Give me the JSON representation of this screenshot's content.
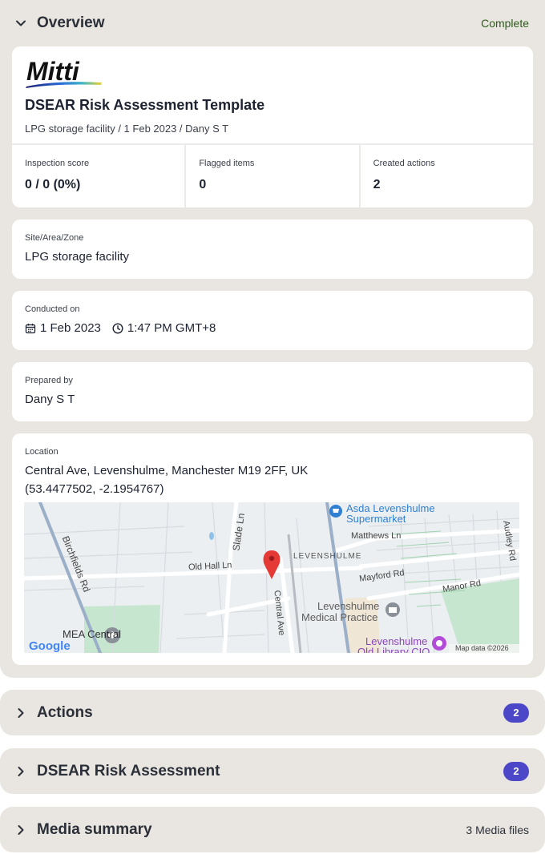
{
  "overview": {
    "title": "Overview",
    "status": "Complete",
    "logo_text": "Mitti",
    "template_title": "DSEAR Risk Assessment Template",
    "subtitle": "LPG storage facility / 1 Feb 2023 / Dany S T",
    "stats": [
      {
        "label": "Inspection score",
        "value": "0 / 0 (0%)"
      },
      {
        "label": "Flagged items",
        "value": "0"
      },
      {
        "label": "Created actions",
        "value": "2"
      }
    ],
    "site": {
      "label": "Site/Area/Zone",
      "value": "LPG storage facility"
    },
    "conducted": {
      "label": "Conducted on",
      "date": "1 Feb 2023",
      "time": "1:47 PM GMT+8"
    },
    "prepared": {
      "label": "Prepared by",
      "value": "Dany S T"
    },
    "location": {
      "label": "Location",
      "address": "Central Ave, Levenshulme, Manchester M19 2FF, UK",
      "coords": "(53.4477502, -2.1954767)"
    },
    "map": {
      "labels": {
        "asda": "Asda Levenshulme",
        "asda2": "Supermarket",
        "matthews": "Matthews Ln",
        "levenshulme": "LEVENSHULME",
        "mayford": "Mayford Rd",
        "manor": "Manor Rd",
        "audley": "Audley Rd",
        "birchfields": "Birchfields Rd",
        "slade": "Slade Ln",
        "oldhall": "Old Hall Ln",
        "central": "Central Ave",
        "medical": "Levenshulme",
        "medical2": "Medical Practice",
        "mea": "MEA Central",
        "library": "Levenshulme",
        "library2": "Old Library CIO",
        "google": "Google",
        "mapdata": "Map data ©2026"
      }
    }
  },
  "sections": {
    "actions": {
      "title": "Actions",
      "badge": "2"
    },
    "dsear": {
      "title": "DSEAR Risk Assessment",
      "badge": "2"
    },
    "media": {
      "title": "Media summary",
      "meta": "3 Media files"
    }
  },
  "colors": {
    "section_bg": "#e9e6e1",
    "badge": "#4b47c8",
    "status_green": "#2e5a1c"
  }
}
